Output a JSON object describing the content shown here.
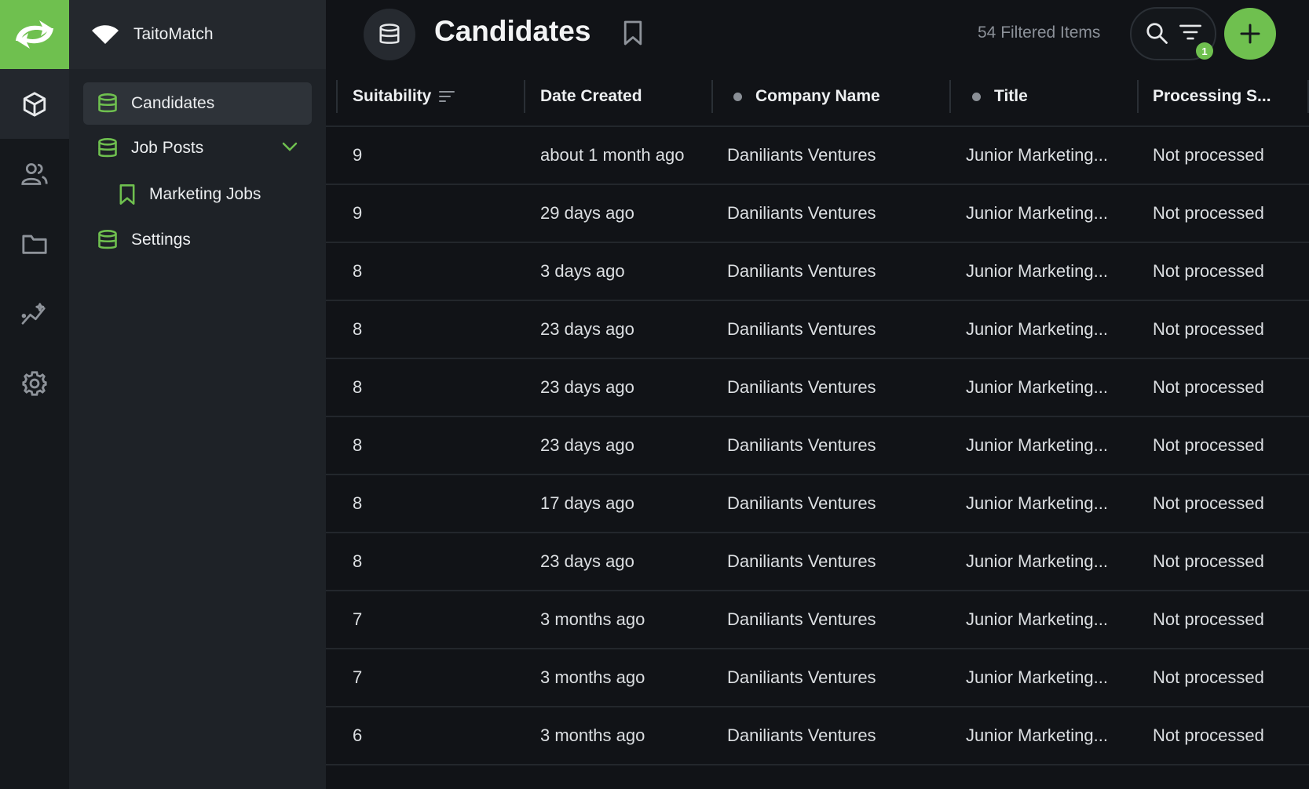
{
  "app": {
    "workspace_name": "TaitoMatch",
    "accent_color": "#6fc04f"
  },
  "rail": {
    "items": [
      {
        "icon": "cube-icon",
        "active": true
      },
      {
        "icon": "users-icon",
        "active": false
      },
      {
        "icon": "folder-icon",
        "active": false
      },
      {
        "icon": "analytics-icon",
        "active": false
      },
      {
        "icon": "gear-icon",
        "active": false
      }
    ]
  },
  "sidebar": {
    "items": [
      {
        "label": "Candidates",
        "icon": "database-icon",
        "active": true
      },
      {
        "label": "Job Posts",
        "icon": "database-icon",
        "expanded": true
      },
      {
        "label": "Marketing Jobs",
        "icon": "bookmark-icon"
      },
      {
        "label": "Settings",
        "icon": "database-icon"
      }
    ]
  },
  "header": {
    "title": "Candidates",
    "filtered_count": "54 Filtered Items",
    "filter_badge": "1"
  },
  "table": {
    "columns": [
      "Suitability",
      "Date Created",
      "Company Name",
      "Title",
      "Processing S..."
    ],
    "rows": [
      [
        "9",
        "about 1 month ago",
        "Daniliants Ventures",
        "Junior Marketing...",
        "Not processed"
      ],
      [
        "9",
        "29 days ago",
        "Daniliants Ventures",
        "Junior Marketing...",
        "Not processed"
      ],
      [
        "8",
        "3 days ago",
        "Daniliants Ventures",
        "Junior Marketing...",
        "Not processed"
      ],
      [
        "8",
        "23 days ago",
        "Daniliants Ventures",
        "Junior Marketing...",
        "Not processed"
      ],
      [
        "8",
        "23 days ago",
        "Daniliants Ventures",
        "Junior Marketing...",
        "Not processed"
      ],
      [
        "8",
        "23 days ago",
        "Daniliants Ventures",
        "Junior Marketing...",
        "Not processed"
      ],
      [
        "8",
        "17 days ago",
        "Daniliants Ventures",
        "Junior Marketing...",
        "Not processed"
      ],
      [
        "8",
        "23 days ago",
        "Daniliants Ventures",
        "Junior Marketing...",
        "Not processed"
      ],
      [
        "7",
        "3 months ago",
        "Daniliants Ventures",
        "Junior Marketing...",
        "Not processed"
      ],
      [
        "7",
        "3 months ago",
        "Daniliants Ventures",
        "Junior Marketing...",
        "Not processed"
      ],
      [
        "6",
        "3 months ago",
        "Daniliants Ventures",
        "Junior Marketing...",
        "Not processed"
      ]
    ]
  }
}
